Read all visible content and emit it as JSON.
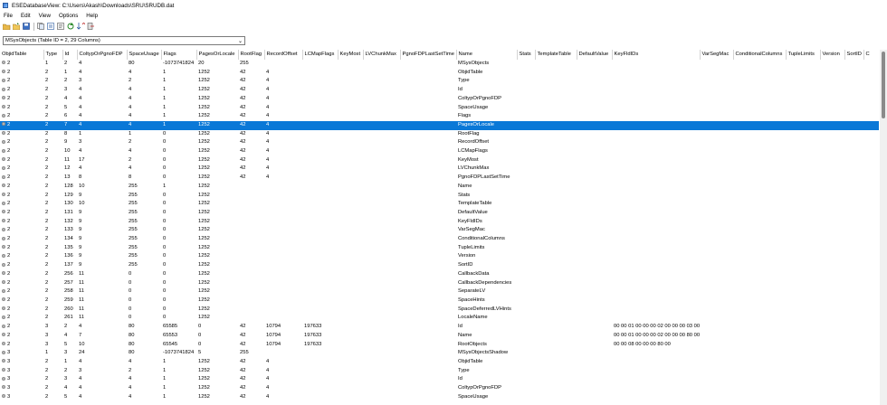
{
  "window": {
    "title": "ESEDatabaseView: C:\\Users\\Akash\\Downloads\\SRU\\SRUDB.dat"
  },
  "menu": [
    "File",
    "Edit",
    "View",
    "Options",
    "Help"
  ],
  "toolbar": {
    "icons": [
      "save-icon",
      "open-icon",
      "copy-icon",
      "html-report-icon",
      "properties-icon",
      "refresh-icon",
      "sort-icon",
      "exit-icon"
    ]
  },
  "table_selector": {
    "value": "MSysObjects   (Table ID = 2, 29 Columns)"
  },
  "grid": {
    "columns": [
      "ObjidTable",
      "Type",
      "Id",
      "ColtypOrPgnoFDP",
      "SpaceUsage",
      "Flags",
      "PagesOrLocale",
      "RootFlag",
      "RecordOffset",
      "LCMapFlags",
      "KeyMost",
      "LVChunkMax",
      "PgnoFDPLastSetTime",
      "Name",
      "Stats",
      "TemplateTable",
      "DefaultValue",
      "KeyFldIDs",
      "VarSegMac",
      "ConditionalColumns",
      "TupleLimits",
      "Version",
      "SortID",
      "C"
    ],
    "selected_row": 7,
    "rows": [
      [
        "2",
        "1",
        "2",
        "4",
        "80",
        "-1073741824",
        "20",
        "255",
        "",
        "",
        "",
        "",
        "",
        "MSysObjects",
        "",
        "",
        "",
        "",
        "",
        "",
        "",
        "",
        "",
        ""
      ],
      [
        "2",
        "2",
        "1",
        "4",
        "4",
        "1",
        "1252",
        "42",
        "4",
        "",
        "",
        "",
        "",
        "ObjidTable",
        "",
        "",
        "",
        "",
        "",
        "",
        "",
        "",
        "",
        ""
      ],
      [
        "2",
        "2",
        "2",
        "3",
        "2",
        "1",
        "1252",
        "42",
        "4",
        "",
        "",
        "",
        "",
        "Type",
        "",
        "",
        "",
        "",
        "",
        "",
        "",
        "",
        "",
        ""
      ],
      [
        "2",
        "2",
        "3",
        "4",
        "4",
        "1",
        "1252",
        "42",
        "4",
        "",
        "",
        "",
        "",
        "Id",
        "",
        "",
        "",
        "",
        "",
        "",
        "",
        "",
        "",
        ""
      ],
      [
        "2",
        "2",
        "4",
        "4",
        "4",
        "1",
        "1252",
        "42",
        "4",
        "",
        "",
        "",
        "",
        "ColtypOrPgnoFDP",
        "",
        "",
        "",
        "",
        "",
        "",
        "",
        "",
        "",
        ""
      ],
      [
        "2",
        "2",
        "5",
        "4",
        "4",
        "1",
        "1252",
        "42",
        "4",
        "",
        "",
        "",
        "",
        "SpaceUsage",
        "",
        "",
        "",
        "",
        "",
        "",
        "",
        "",
        "",
        ""
      ],
      [
        "2",
        "2",
        "6",
        "4",
        "4",
        "1",
        "1252",
        "42",
        "4",
        "",
        "",
        "",
        "",
        "Flags",
        "",
        "",
        "",
        "",
        "",
        "",
        "",
        "",
        "",
        ""
      ],
      [
        "2",
        "2",
        "7",
        "4",
        "4",
        "1",
        "1252",
        "42",
        "4",
        "",
        "",
        "",
        "",
        "PagesOrLocale",
        "",
        "",
        "",
        "",
        "",
        "",
        "",
        "",
        "",
        ""
      ],
      [
        "2",
        "2",
        "8",
        "1",
        "1",
        "0",
        "1252",
        "42",
        "4",
        "",
        "",
        "",
        "",
        "RootFlag",
        "",
        "",
        "",
        "",
        "",
        "",
        "",
        "",
        "",
        ""
      ],
      [
        "2",
        "2",
        "9",
        "3",
        "2",
        "0",
        "1252",
        "42",
        "4",
        "",
        "",
        "",
        "",
        "RecordOffset",
        "",
        "",
        "",
        "",
        "",
        "",
        "",
        "",
        "",
        ""
      ],
      [
        "2",
        "2",
        "10",
        "4",
        "4",
        "0",
        "1252",
        "42",
        "4",
        "",
        "",
        "",
        "",
        "LCMapFlags",
        "",
        "",
        "",
        "",
        "",
        "",
        "",
        "",
        "",
        ""
      ],
      [
        "2",
        "2",
        "11",
        "17",
        "2",
        "0",
        "1252",
        "42",
        "4",
        "",
        "",
        "",
        "",
        "KeyMost",
        "",
        "",
        "",
        "",
        "",
        "",
        "",
        "",
        "",
        ""
      ],
      [
        "2",
        "2",
        "12",
        "4",
        "4",
        "0",
        "1252",
        "42",
        "4",
        "",
        "",
        "",
        "",
        "LVChunkMax",
        "",
        "",
        "",
        "",
        "",
        "",
        "",
        "",
        "",
        ""
      ],
      [
        "2",
        "2",
        "13",
        "8",
        "8",
        "0",
        "1252",
        "42",
        "4",
        "",
        "",
        "",
        "",
        "PgnoFDPLastSetTime",
        "",
        "",
        "",
        "",
        "",
        "",
        "",
        "",
        "",
        ""
      ],
      [
        "2",
        "2",
        "128",
        "10",
        "255",
        "1",
        "1252",
        "",
        "",
        "",
        "",
        "",
        "",
        "Name",
        "",
        "",
        "",
        "",
        "",
        "",
        "",
        "",
        "",
        ""
      ],
      [
        "2",
        "2",
        "129",
        "9",
        "255",
        "0",
        "1252",
        "",
        "",
        "",
        "",
        "",
        "",
        "Stats",
        "",
        "",
        "",
        "",
        "",
        "",
        "",
        "",
        "",
        ""
      ],
      [
        "2",
        "2",
        "130",
        "10",
        "255",
        "0",
        "1252",
        "",
        "",
        "",
        "",
        "",
        "",
        "TemplateTable",
        "",
        "",
        "",
        "",
        "",
        "",
        "",
        "",
        "",
        ""
      ],
      [
        "2",
        "2",
        "131",
        "9",
        "255",
        "0",
        "1252",
        "",
        "",
        "",
        "",
        "",
        "",
        "DefaultValue",
        "",
        "",
        "",
        "",
        "",
        "",
        "",
        "",
        "",
        ""
      ],
      [
        "2",
        "2",
        "132",
        "9",
        "255",
        "0",
        "1252",
        "",
        "",
        "",
        "",
        "",
        "",
        "KeyFldIDs",
        "",
        "",
        "",
        "",
        "",
        "",
        "",
        "",
        "",
        ""
      ],
      [
        "2",
        "2",
        "133",
        "9",
        "255",
        "0",
        "1252",
        "",
        "",
        "",
        "",
        "",
        "",
        "VarSegMac",
        "",
        "",
        "",
        "",
        "",
        "",
        "",
        "",
        "",
        ""
      ],
      [
        "2",
        "2",
        "134",
        "9",
        "255",
        "0",
        "1252",
        "",
        "",
        "",
        "",
        "",
        "",
        "ConditionalColumns",
        "",
        "",
        "",
        "",
        "",
        "",
        "",
        "",
        "",
        ""
      ],
      [
        "2",
        "2",
        "135",
        "9",
        "255",
        "0",
        "1252",
        "",
        "",
        "",
        "",
        "",
        "",
        "TupleLimits",
        "",
        "",
        "",
        "",
        "",
        "",
        "",
        "",
        "",
        ""
      ],
      [
        "2",
        "2",
        "136",
        "9",
        "255",
        "0",
        "1252",
        "",
        "",
        "",
        "",
        "",
        "",
        "Version",
        "",
        "",
        "",
        "",
        "",
        "",
        "",
        "",
        "",
        ""
      ],
      [
        "2",
        "2",
        "137",
        "9",
        "255",
        "0",
        "1252",
        "",
        "",
        "",
        "",
        "",
        "",
        "SortID",
        "",
        "",
        "",
        "",
        "",
        "",
        "",
        "",
        "",
        ""
      ],
      [
        "2",
        "2",
        "256",
        "11",
        "0",
        "0",
        "1252",
        "",
        "",
        "",
        "",
        "",
        "",
        "CallbackData",
        "",
        "",
        "",
        "",
        "",
        "",
        "",
        "",
        "",
        ""
      ],
      [
        "2",
        "2",
        "257",
        "11",
        "0",
        "0",
        "1252",
        "",
        "",
        "",
        "",
        "",
        "",
        "CallbackDependencies",
        "",
        "",
        "",
        "",
        "",
        "",
        "",
        "",
        "",
        ""
      ],
      [
        "2",
        "2",
        "258",
        "11",
        "0",
        "0",
        "1252",
        "",
        "",
        "",
        "",
        "",
        "",
        "SeparateLV",
        "",
        "",
        "",
        "",
        "",
        "",
        "",
        "",
        "",
        ""
      ],
      [
        "2",
        "2",
        "259",
        "11",
        "0",
        "0",
        "1252",
        "",
        "",
        "",
        "",
        "",
        "",
        "SpaceHints",
        "",
        "",
        "",
        "",
        "",
        "",
        "",
        "",
        "",
        ""
      ],
      [
        "2",
        "2",
        "260",
        "11",
        "0",
        "0",
        "1252",
        "",
        "",
        "",
        "",
        "",
        "",
        "SpaceDeferredLVHints",
        "",
        "",
        "",
        "",
        "",
        "",
        "",
        "",
        "",
        ""
      ],
      [
        "2",
        "2",
        "261",
        "11",
        "0",
        "0",
        "1252",
        "",
        "",
        "",
        "",
        "",
        "",
        "LocaleName",
        "",
        "",
        "",
        "",
        "",
        "",
        "",
        "",
        "",
        ""
      ],
      [
        "2",
        "3",
        "2",
        "4",
        "80",
        "65585",
        "0",
        "42",
        "10794",
        "197633",
        "",
        "",
        "",
        "Id",
        "",
        "",
        "",
        "00 00 01 00 00 00 02 00 00 00 03 00",
        "",
        "",
        "",
        "",
        "",
        ""
      ],
      [
        "2",
        "3",
        "4",
        "7",
        "80",
        "65553",
        "0",
        "42",
        "10794",
        "197633",
        "",
        "",
        "",
        "Name",
        "",
        "",
        "",
        "00 00 01 00 00 00 02 00 00 00 80 00",
        "",
        "",
        "",
        "",
        "",
        ""
      ],
      [
        "2",
        "3",
        "5",
        "10",
        "80",
        "65545",
        "0",
        "42",
        "10794",
        "197633",
        "",
        "",
        "",
        "RootObjects",
        "",
        "",
        "",
        "00 00 08 00 00 00 80 00",
        "",
        "",
        "",
        "",
        "",
        ""
      ],
      [
        "3",
        "1",
        "3",
        "24",
        "80",
        "-1073741824",
        "5",
        "255",
        "",
        "",
        "",
        "",
        "",
        "MSysObjectsShadow",
        "",
        "",
        "",
        "",
        "",
        "",
        "",
        "",
        "",
        ""
      ],
      [
        "3",
        "2",
        "1",
        "4",
        "4",
        "1",
        "1252",
        "42",
        "4",
        "",
        "",
        "",
        "",
        "ObjidTable",
        "",
        "",
        "",
        "",
        "",
        "",
        "",
        "",
        "",
        ""
      ],
      [
        "3",
        "2",
        "2",
        "3",
        "2",
        "1",
        "1252",
        "42",
        "4",
        "",
        "",
        "",
        "",
        "Type",
        "",
        "",
        "",
        "",
        "",
        "",
        "",
        "",
        "",
        ""
      ],
      [
        "3",
        "2",
        "3",
        "4",
        "4",
        "1",
        "1252",
        "42",
        "4",
        "",
        "",
        "",
        "",
        "Id",
        "",
        "",
        "",
        "",
        "",
        "",
        "",
        "",
        "",
        ""
      ],
      [
        "3",
        "2",
        "4",
        "4",
        "4",
        "1",
        "1252",
        "42",
        "4",
        "",
        "",
        "",
        "",
        "ColtypOrPgnoFDP",
        "",
        "",
        "",
        "",
        "",
        "",
        "",
        "",
        "",
        ""
      ],
      [
        "3",
        "2",
        "5",
        "4",
        "4",
        "1",
        "1252",
        "42",
        "4",
        "",
        "",
        "",
        "",
        "SpaceUsage",
        "",
        "",
        "",
        "",
        "",
        "",
        "",
        "",
        "",
        ""
      ]
    ]
  }
}
